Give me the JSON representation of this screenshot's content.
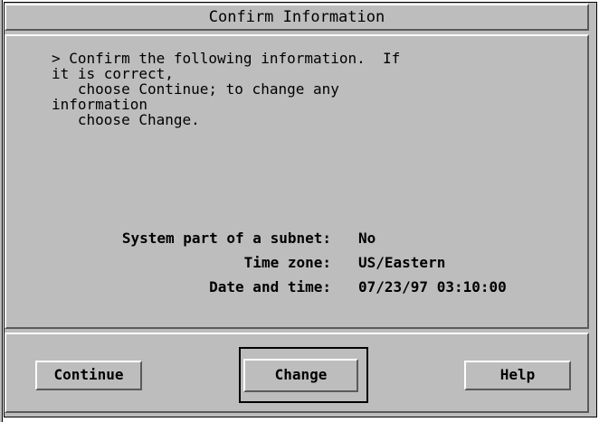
{
  "window": {
    "title": "Confirm Information"
  },
  "message": {
    "lines": [
      "> Confirm the following information.  If",
      "it is correct,",
      "   choose Continue; to change any",
      "information",
      "   choose Change."
    ]
  },
  "info": [
    {
      "label": "System part of a subnet:",
      "value": "No"
    },
    {
      "label": "Time zone:",
      "value": "US/Eastern"
    },
    {
      "label": "Date and time:",
      "value": "07/23/97 03:10:00"
    }
  ],
  "buttons": {
    "continue": "Continue",
    "change": "Change",
    "help": "Help",
    "default": "change"
  },
  "colors": {
    "panel": "#bdbdbd",
    "highlight": "#ffffff",
    "shadow": "#5a5a5a"
  }
}
